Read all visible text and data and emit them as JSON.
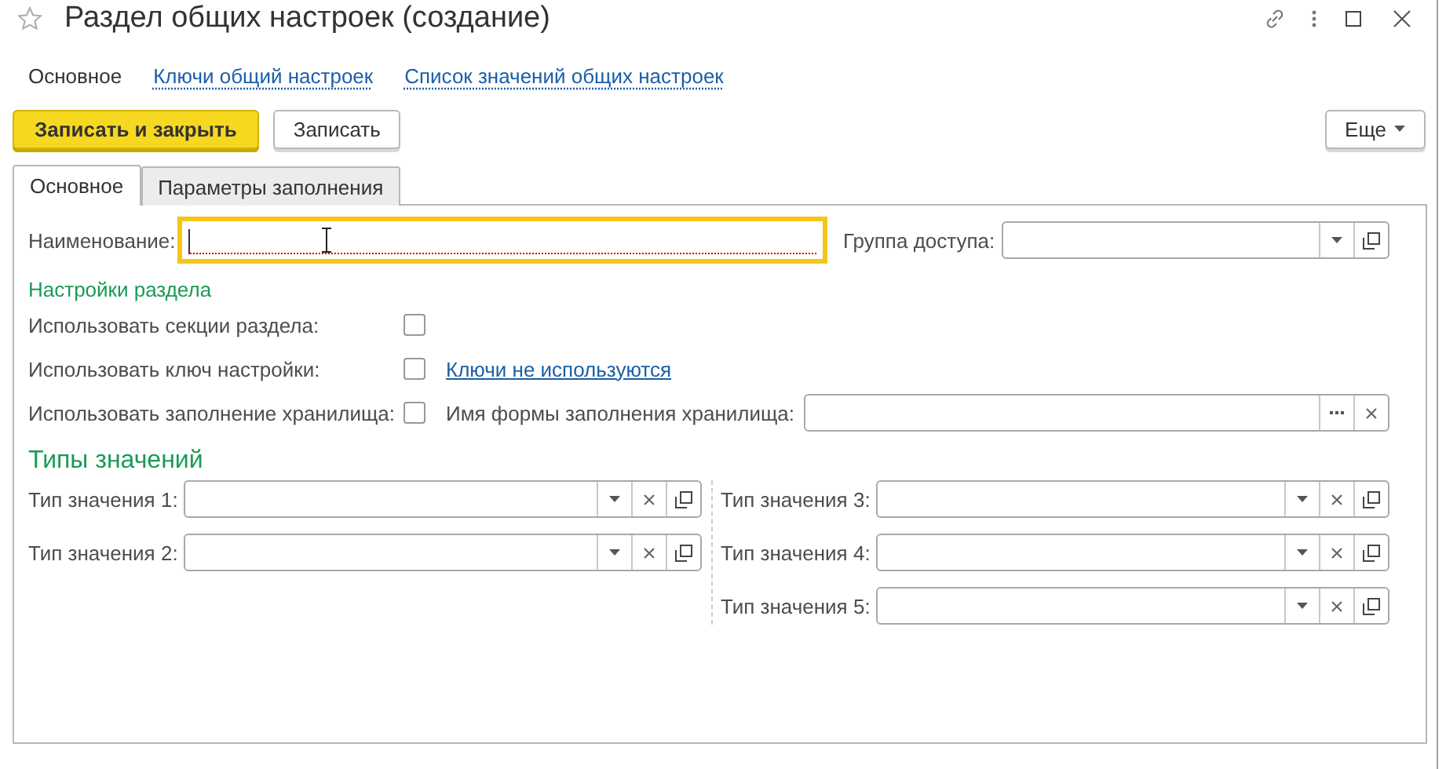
{
  "window": {
    "title": "Раздел общих настроек (создание)"
  },
  "nav": [
    {
      "label": "Основное",
      "selected": true
    },
    {
      "label": "Ключи общий настроек",
      "selected": false
    },
    {
      "label": "Список значений общих настроек",
      "selected": false
    }
  ],
  "toolbar": {
    "buttons": [
      {
        "label": "Записать и закрыть",
        "kind": "primary"
      },
      {
        "label": "Записать",
        "kind": "normal"
      }
    ],
    "more": "Еще"
  },
  "tabs": [
    {
      "label": "Основное",
      "selected": true
    },
    {
      "label": "Параметры заполнения",
      "selected": false
    }
  ],
  "name_field": {
    "label": "Наименование:",
    "focused": true,
    "required": true
  },
  "access_group": {
    "label": "Группа доступа:",
    "buttons": [
      {
        "kind": "dropdown"
      },
      {
        "kind": "open"
      }
    ]
  },
  "section_settings": {
    "title": "Настройки раздела",
    "rows": [
      {
        "label": "Использовать секции раздела:",
        "checked": false
      },
      {
        "label": "Использовать ключ настройки:",
        "checked": false,
        "link": "Ключи не используются"
      },
      {
        "label": "Использовать заполнение хранилища:",
        "checked": false,
        "field": {
          "label": "Имя формы заполнения хранилища:",
          "buttons": [
            {
              "kind": "select"
            },
            {
              "kind": "clear"
            }
          ]
        }
      }
    ]
  },
  "value_types": {
    "title": "Типы значений",
    "columns": [
      [
        {
          "label": "Тип значения 1:",
          "buttons": [
            {
              "kind": "dropdown"
            },
            {
              "kind": "clear"
            },
            {
              "kind": "open"
            }
          ]
        },
        {
          "label": "Тип значения 2:",
          "buttons": [
            {
              "kind": "dropdown"
            },
            {
              "kind": "clear"
            },
            {
              "kind": "open"
            }
          ]
        }
      ],
      [
        {
          "label": "Тип значения 3:",
          "buttons": [
            {
              "kind": "dropdown"
            },
            {
              "kind": "clear"
            },
            {
              "kind": "open"
            }
          ]
        },
        {
          "label": "Тип значения 4:",
          "buttons": [
            {
              "kind": "dropdown"
            },
            {
              "kind": "clear"
            },
            {
              "kind": "open"
            }
          ]
        },
        {
          "label": "Тип значения 5:",
          "buttons": [
            {
              "kind": "dropdown"
            },
            {
              "kind": "clear"
            },
            {
              "kind": "open"
            }
          ]
        }
      ]
    ]
  }
}
